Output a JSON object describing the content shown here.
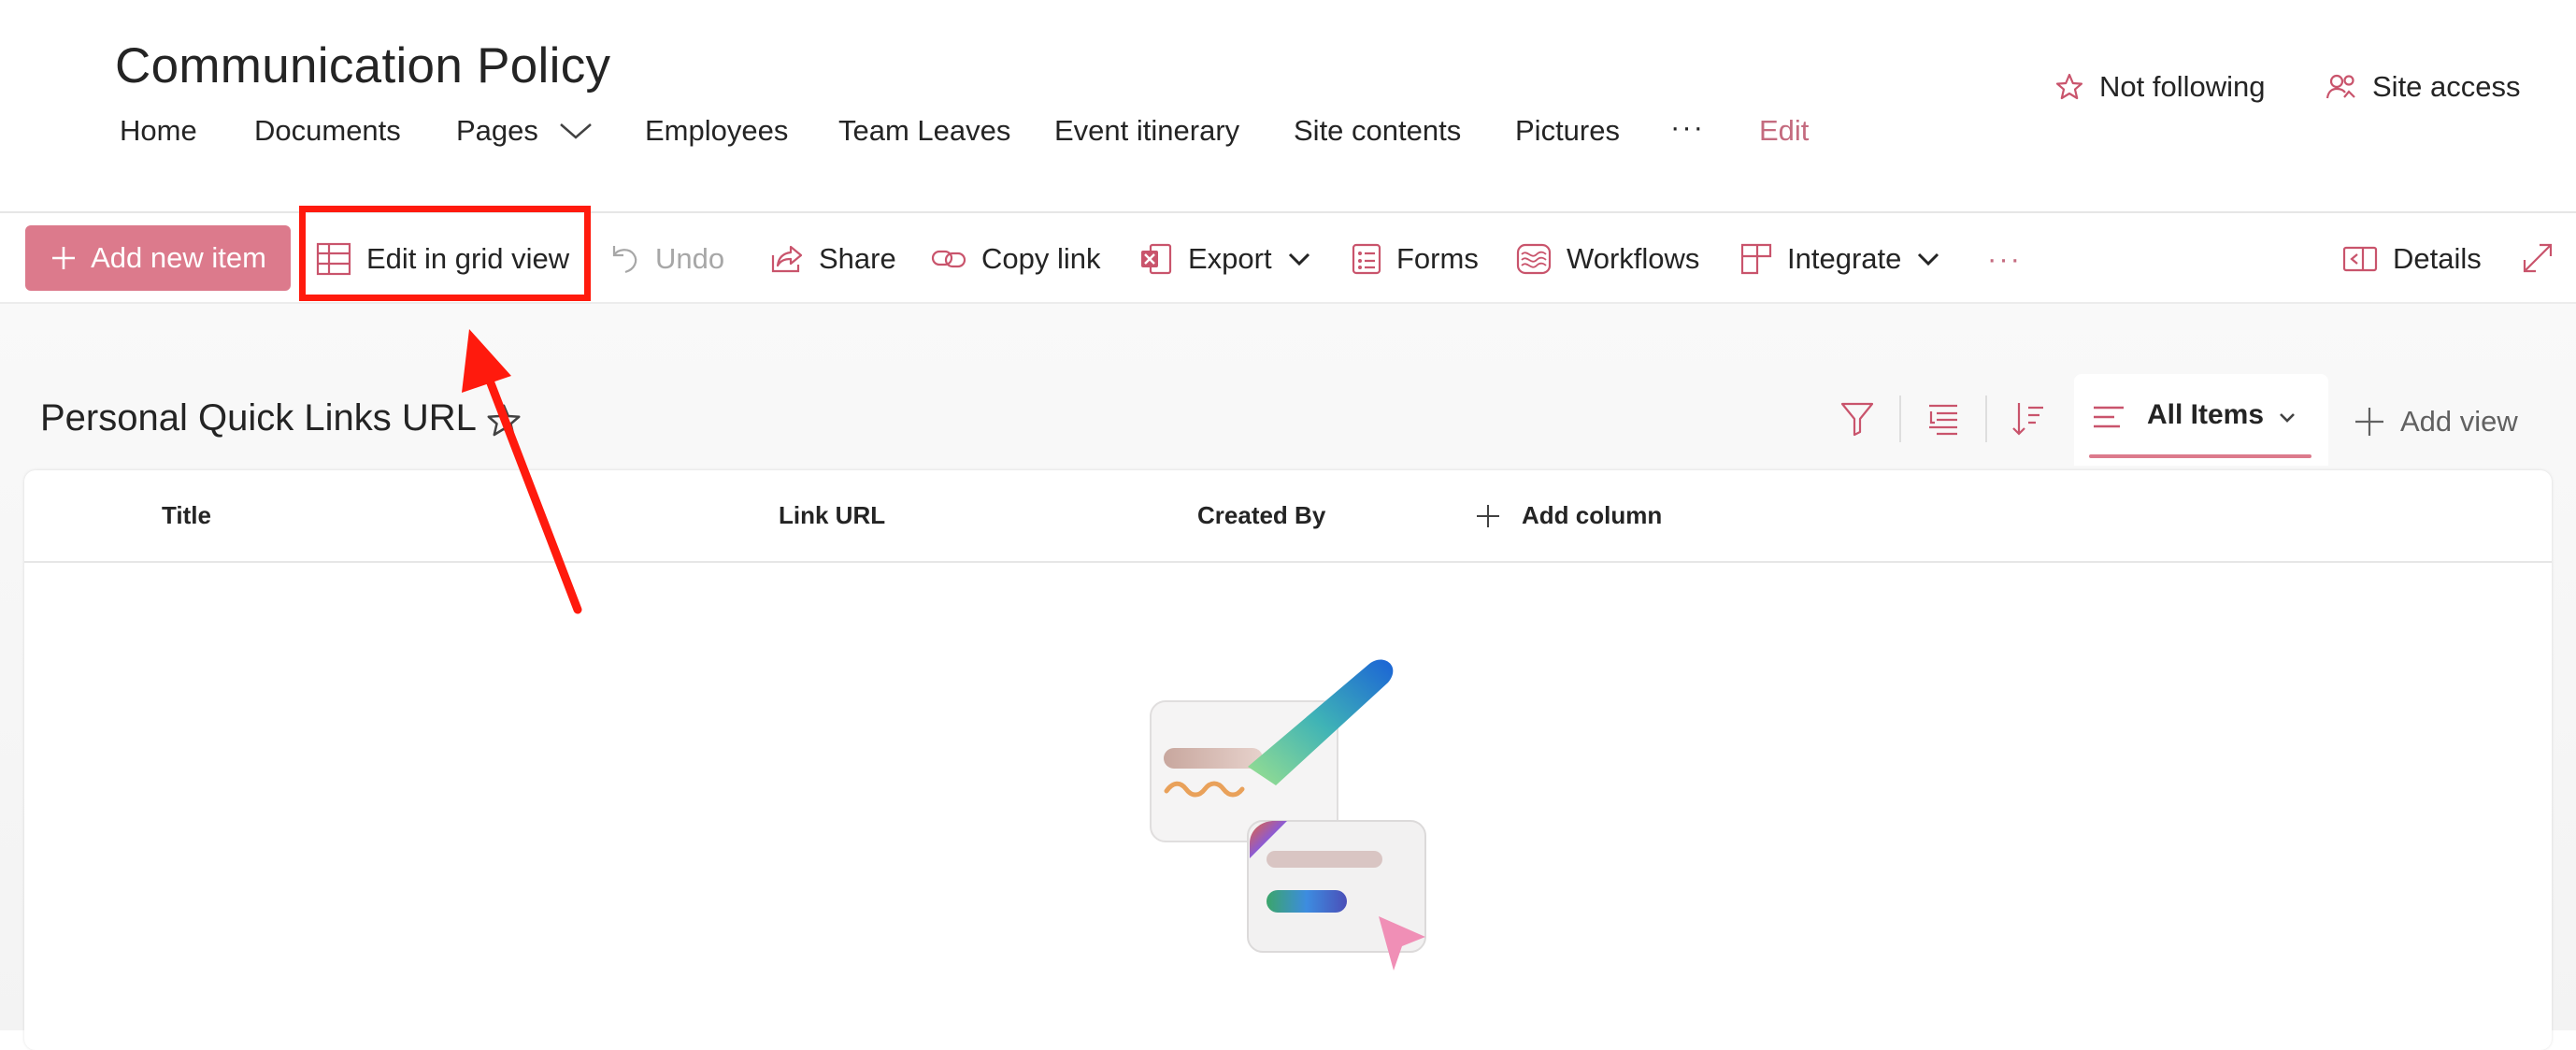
{
  "site": {
    "title": "Communication Policy"
  },
  "nav": {
    "home": "Home",
    "documents": "Documents",
    "pages": "Pages",
    "employees": "Employees",
    "team_leaves": "Team Leaves",
    "event_itinerary": "Event itinerary",
    "site_contents": "Site contents",
    "pictures": "Pictures",
    "more": "···",
    "edit": "Edit"
  },
  "header_actions": {
    "follow": "Not following",
    "site_access": "Site access"
  },
  "command_bar": {
    "add_new_item": "Add new item",
    "edit_grid": "Edit in grid view",
    "undo": "Undo",
    "share": "Share",
    "copy_link": "Copy link",
    "export": "Export",
    "forms": "Forms",
    "workflows": "Workflows",
    "integrate": "Integrate",
    "more": "···",
    "details": "Details"
  },
  "list": {
    "title": "Personal Quick Links URL",
    "view_name": "All Items",
    "add_view": "Add view",
    "columns": [
      "Title",
      "Link URL",
      "Created By"
    ],
    "add_column": "Add column"
  },
  "colors": {
    "accent": "#dc7a8c",
    "annotation": "#ff1a0d"
  }
}
